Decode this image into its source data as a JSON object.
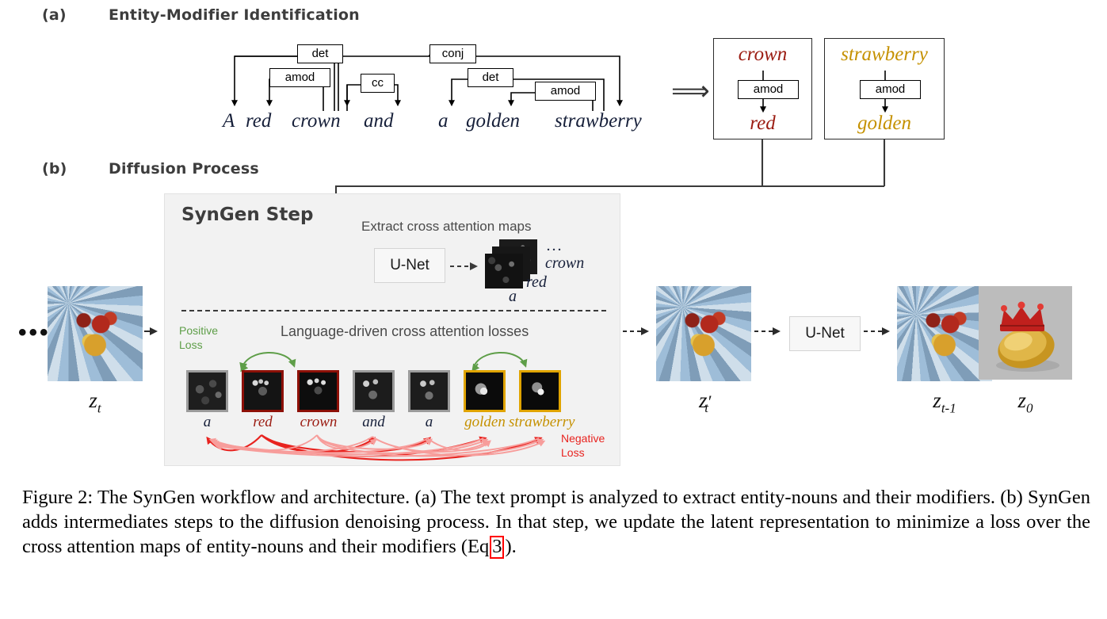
{
  "figure": {
    "sections": [
      {
        "letter": "(a)",
        "title": "Entity-Modifier Identification"
      },
      {
        "letter": "(b)",
        "title": "Diffusion Process"
      }
    ]
  },
  "parse": {
    "words": [
      {
        "text": "A",
        "color": "dark"
      },
      {
        "text": "red",
        "color": "dark"
      },
      {
        "text": "crown",
        "color": "dark"
      },
      {
        "text": "and",
        "color": "dark"
      },
      {
        "text": "a",
        "color": "dark"
      },
      {
        "text": "golden",
        "color": "dark"
      },
      {
        "text": "strawberry",
        "color": "dark"
      }
    ],
    "relations": [
      {
        "label": "det"
      },
      {
        "label": "amod"
      },
      {
        "label": "cc"
      },
      {
        "label": "conj"
      },
      {
        "label": "det"
      },
      {
        "label": "amod"
      }
    ],
    "implies_symbol": "⟹"
  },
  "entity_boxes": [
    {
      "head": "crown",
      "relation": "amod",
      "modifier": "red",
      "color": "#9b1c12"
    },
    {
      "head": "strawberry",
      "relation": "amod",
      "modifier": "golden",
      "color": "#c59100"
    }
  ],
  "syngen": {
    "panel_title": "SynGen Step",
    "extract_label": "Extract cross attention maps",
    "unet_label": "U-Net",
    "stack_labels": {
      "ellipsis": "...",
      "top": "crown",
      "mid": "red",
      "bottom": "a"
    },
    "losses_label": "Language-driven cross attention losses",
    "positive_loss": "Positive\nLoss",
    "positive_loss_line1": "Positive",
    "positive_loss_line2": "Loss",
    "negative_loss_line1": "Negative",
    "negative_loss_line2": "Loss",
    "attention_maps": [
      {
        "word": "a",
        "border": "#9b9b9b",
        "color": "#17203a"
      },
      {
        "word": "red",
        "border": "#8d1007",
        "color": "#9b1c12"
      },
      {
        "word": "crown",
        "border": "#8d1007",
        "color": "#9b1c12"
      },
      {
        "word": "and",
        "border": "#9b9b9b",
        "color": "#17203a"
      },
      {
        "word": "a",
        "border": "#9b9b9b",
        "color": "#17203a"
      },
      {
        "word": "golden",
        "border": "#e0a400",
        "color": "#c59100"
      },
      {
        "word": "strawberry",
        "border": "#e0a400",
        "color": "#c59100"
      }
    ]
  },
  "pipeline": {
    "left_ellipsis": "•••",
    "right_ellipsis": "•••",
    "unet_label": "U-Net",
    "steps": [
      {
        "id": "zt",
        "label_base": "z",
        "label_sub": "t",
        "prime": false
      },
      {
        "id": "ztp",
        "label_base": "z",
        "label_sub": "t",
        "prime": true
      },
      {
        "id": "ztm1",
        "label_base": "z",
        "label_sub": "t-1",
        "prime": false
      },
      {
        "id": "z0",
        "label_base": "z",
        "label_sub": "0",
        "prime": false
      }
    ]
  },
  "caption": {
    "prefix": "Figure 2: The SynGen workflow and architecture. (a) The text prompt is analyzed to extract entity-nouns and their modifiers. (b) SynGen adds intermediates steps to the diffusion denoising process. In that step, we update the latent representation to minimize a loss over the cross attention maps of entity-nouns and their modifiers (Eq",
    "eq_ref": "3",
    "suffix": ")."
  },
  "colors": {
    "red": "#9b1c12",
    "gold": "#c59100",
    "dark": "#17203a",
    "green": "#5e9e48",
    "neg_red": "#e8231f",
    "panel_bg": "#f2f2f2"
  }
}
